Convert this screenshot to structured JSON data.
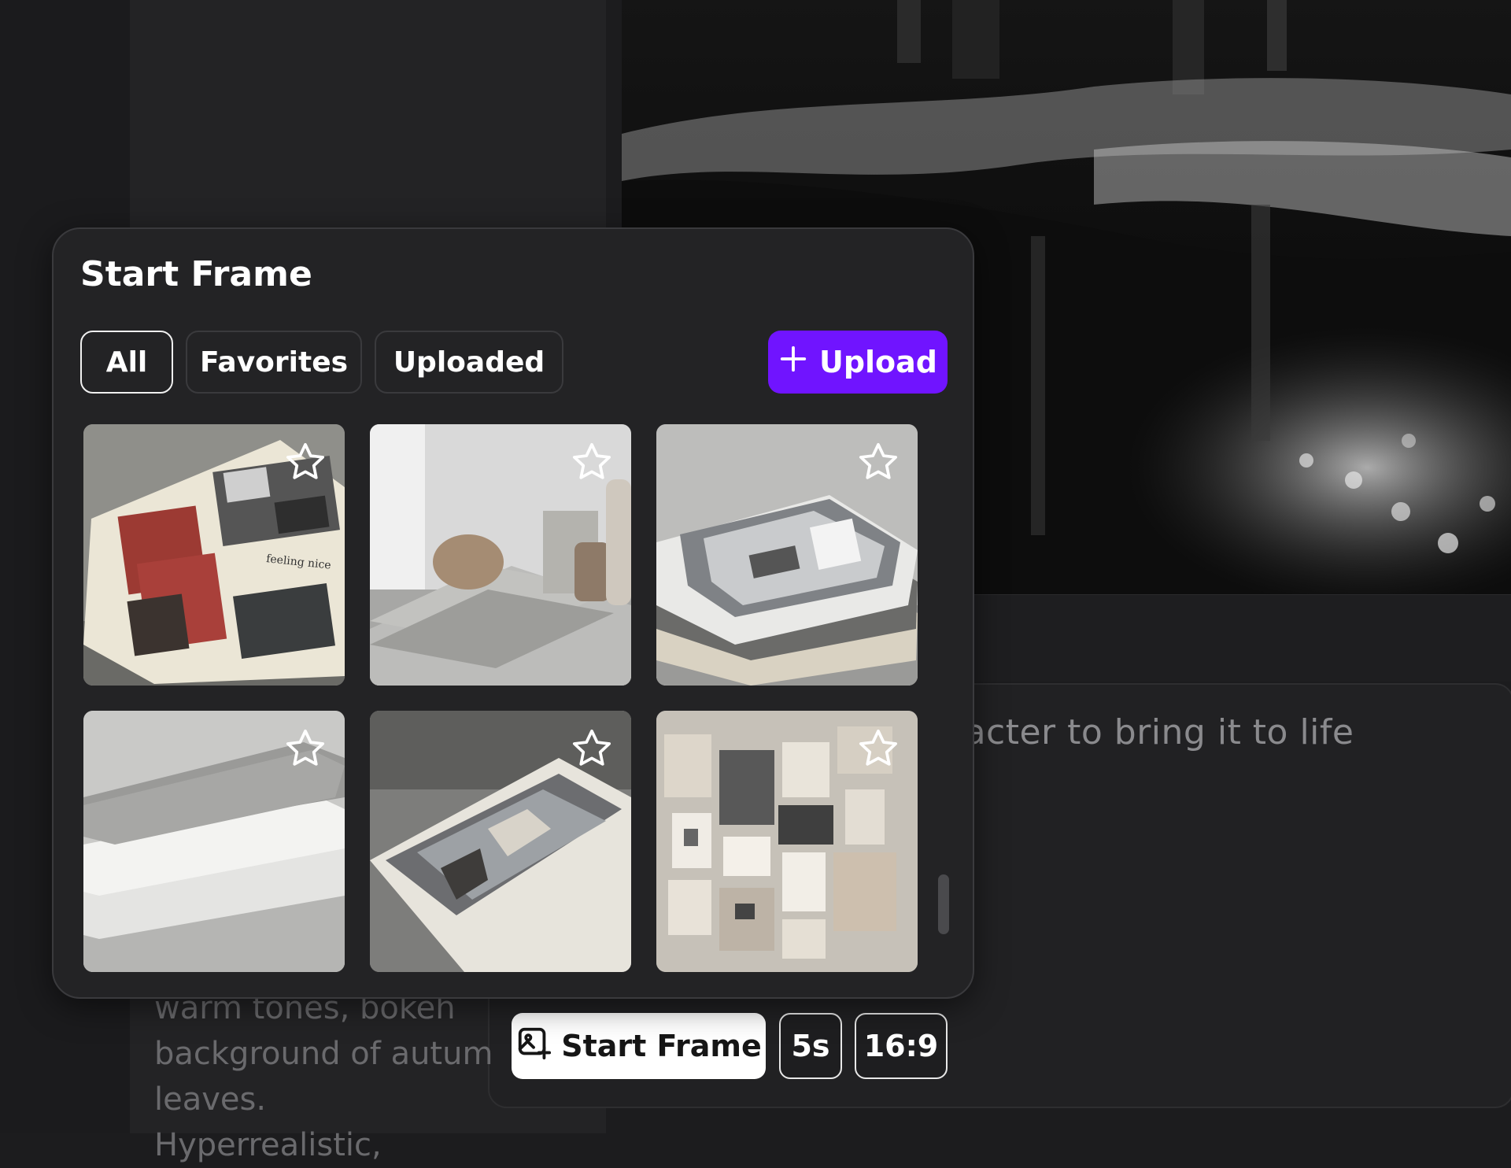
{
  "popup": {
    "title": "Start Frame",
    "tabs": [
      "All",
      "Favorites",
      "Uploaded"
    ],
    "active_tab": "All",
    "upload_label": "Upload",
    "accent_color": "#7014ff",
    "thumbnails": [
      {
        "name": "moodboard-red-board",
        "favorited": false
      },
      {
        "name": "ceramic-vases-on-slabs",
        "favorited": false
      },
      {
        "name": "interior-print-stack",
        "favorited": false
      },
      {
        "name": "grey-board-layers",
        "favorited": false
      },
      {
        "name": "interior-photo-print",
        "favorited": false
      },
      {
        "name": "moodboard-wall-collage",
        "favorited": false
      }
    ],
    "thumbnail_caption": "feeling nice"
  },
  "prompt": {
    "visible_text": "ect a character to bring it to life",
    "left_text": "warm tones, bokeh\nbackground of autum\nleaves. Hyperrealistic,"
  },
  "toolbar": {
    "start_frame_label": "Start Frame",
    "duration": "5s",
    "aspect_ratio": "16:9"
  },
  "icons": {
    "star": "star-icon",
    "plus": "plus-icon",
    "start_frame": "image-add-icon"
  }
}
